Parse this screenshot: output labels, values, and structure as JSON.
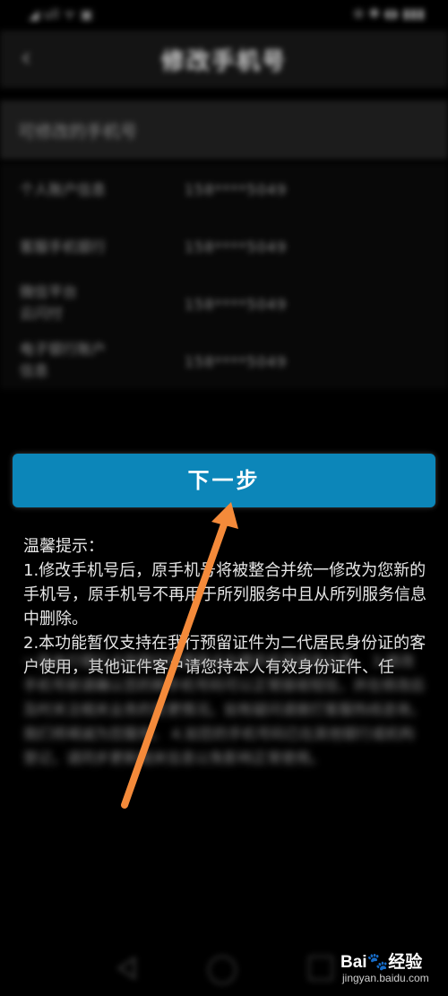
{
  "status_bar": {
    "left": "◢ ull ᯤ ▣",
    "right": "⊛ ✱ ◖◗ ▮▮▮"
  },
  "header": {
    "title": "修改手机号",
    "back_icon": "chevron-left-icon"
  },
  "section": {
    "title": "可修改的手机号"
  },
  "list": {
    "items": [
      {
        "label": "个人账户信息",
        "value": "158****5049"
      },
      {
        "label": "客服手机银行",
        "value": "158****5049"
      },
      {
        "label": "微信平台 云闪付",
        "value": "158****5049"
      },
      {
        "label": "电子银行账户 信息",
        "value": "158****5049"
      }
    ]
  },
  "button": {
    "next_label": "下一步"
  },
  "tips": {
    "title": "温馨提示：",
    "line1": "1.修改手机号后，原手机号将被整合并统一修改为您新的手机号，原手机号不再用于所列服务中且从所列服务信息中删除。",
    "line2": "2.本功能暂仅支持在我行预留证件为二代居民身份证的客户使用，其他证件客户请您持本人有效身份证件、任",
    "blurred": "一张本行银行卡到我行任意网点办理手机号修改业务。 3.修改手机号前请确认您的新手机号码可以正常接收短信，并在修改后及时关注相关业务的变更情况。如有疑问请拨打客服热线咨询，我们将竭诚为您服务。 4.如您的手机号码已在其他银行或机构登记，请同步更新相关信息以免影响正常使用。"
  },
  "nav": {
    "back": "triangle-back-icon",
    "home": "circle-home-icon",
    "recent": "square-recent-icon"
  },
  "watermark": {
    "main": "Bai🐾经验",
    "sub": "jingyan.baidu.com"
  },
  "colors": {
    "accent": "#0c86b9",
    "arrow": "#f48a3a",
    "background": "#000000"
  }
}
